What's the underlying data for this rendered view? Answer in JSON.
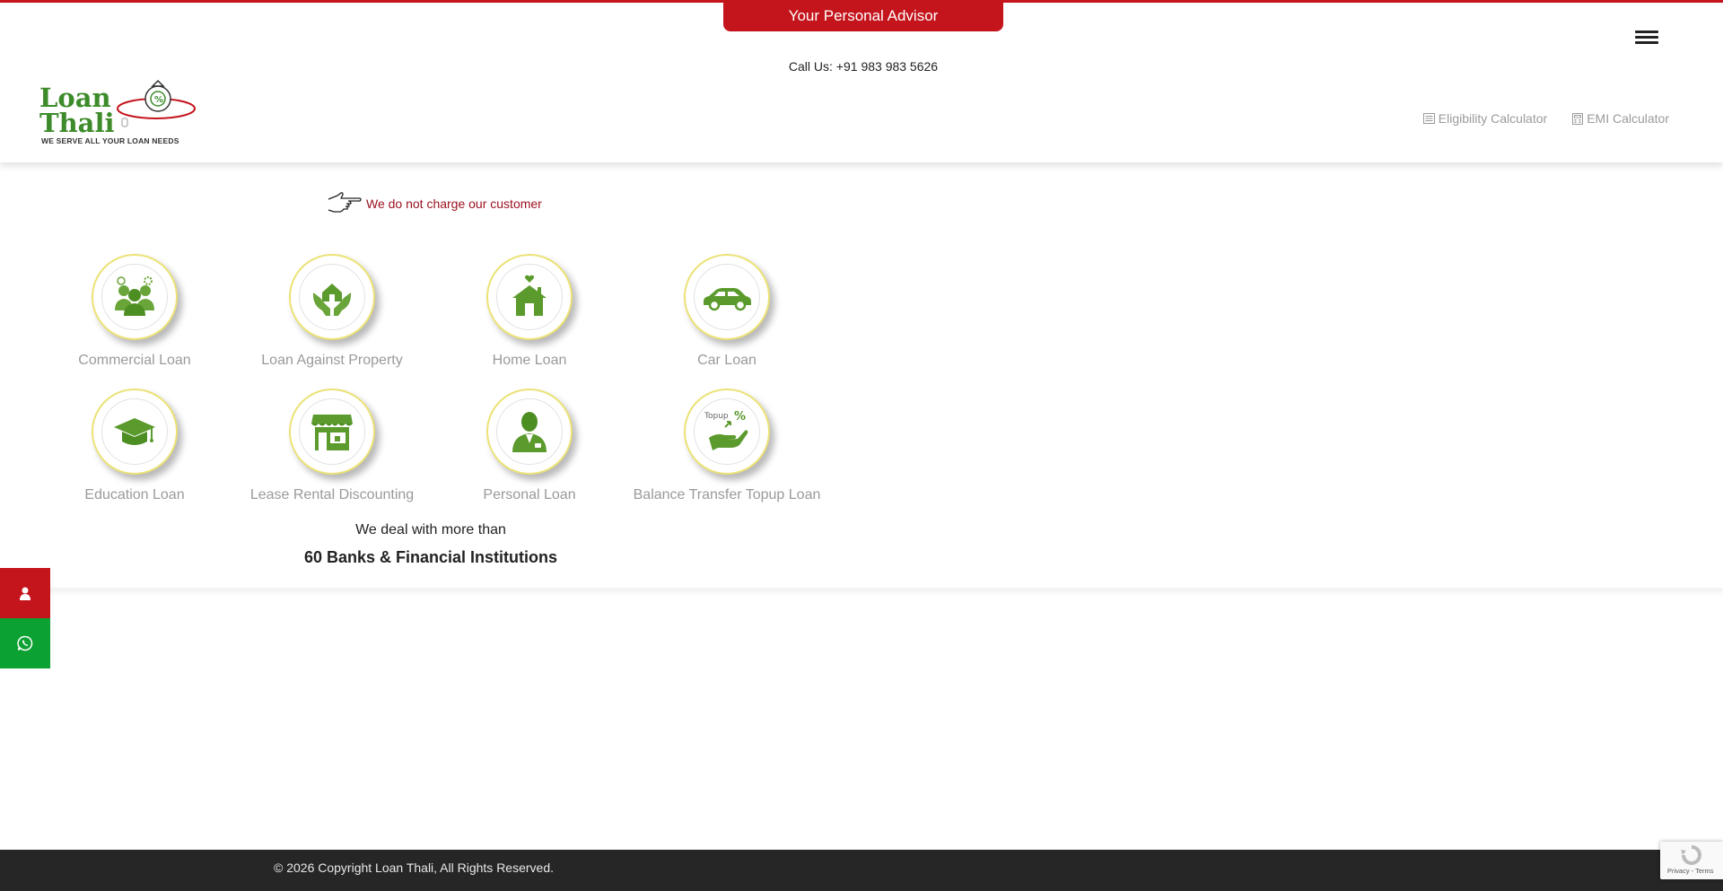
{
  "header": {
    "advisor_tab": "Your Personal Advisor",
    "call_us": "Call Us: +91 983 983 5626",
    "logo": {
      "line1": "Loan",
      "line2": "Thali",
      "tagline": "WE SERVE ALL YOUR LOAN NEEDS"
    },
    "nav_links": [
      {
        "label": "Eligibility Calculator",
        "icon": "list-icon"
      },
      {
        "label": "EMI Calculator",
        "icon": "calculator-icon"
      }
    ],
    "menu_icon": "hamburger-menu-icon"
  },
  "promo": {
    "text": "We do not charge our customer",
    "icon": "pointing-hand-icon"
  },
  "services": [
    {
      "label": "Commercial Loan",
      "icon": "business-people-icon"
    },
    {
      "label": "Loan Against Property",
      "icon": "hands-house-icon"
    },
    {
      "label": "Home Loan",
      "icon": "house-heart-icon"
    },
    {
      "label": "Car Loan",
      "icon": "car-icon"
    },
    {
      "label": "Education Loan",
      "icon": "graduation-cap-icon"
    },
    {
      "label": "Lease Rental Discounting",
      "icon": "shop-icon"
    },
    {
      "label": "Personal Loan",
      "icon": "person-icon"
    },
    {
      "label": "Balance Transfer Topup Loan",
      "icon": "topup-hand-icon"
    }
  ],
  "deal": {
    "line1": "We deal with more than",
    "line2": "60 Banks & Financial Institutions"
  },
  "side_buttons": [
    {
      "icon": "user-icon",
      "color": "#c4141c"
    },
    {
      "icon": "whatsapp-icon",
      "color": "#0ca133"
    }
  ],
  "footer": {
    "copyright": "© 2026 Copyright Loan Thali, All Rights Reserved."
  },
  "recaptcha": {
    "text": "Privacy - Terms"
  },
  "colors": {
    "brand_red": "#c4141c",
    "brand_green": "#3d8b2a",
    "whatsapp_green": "#0ca133",
    "footer_bg": "#262626"
  }
}
